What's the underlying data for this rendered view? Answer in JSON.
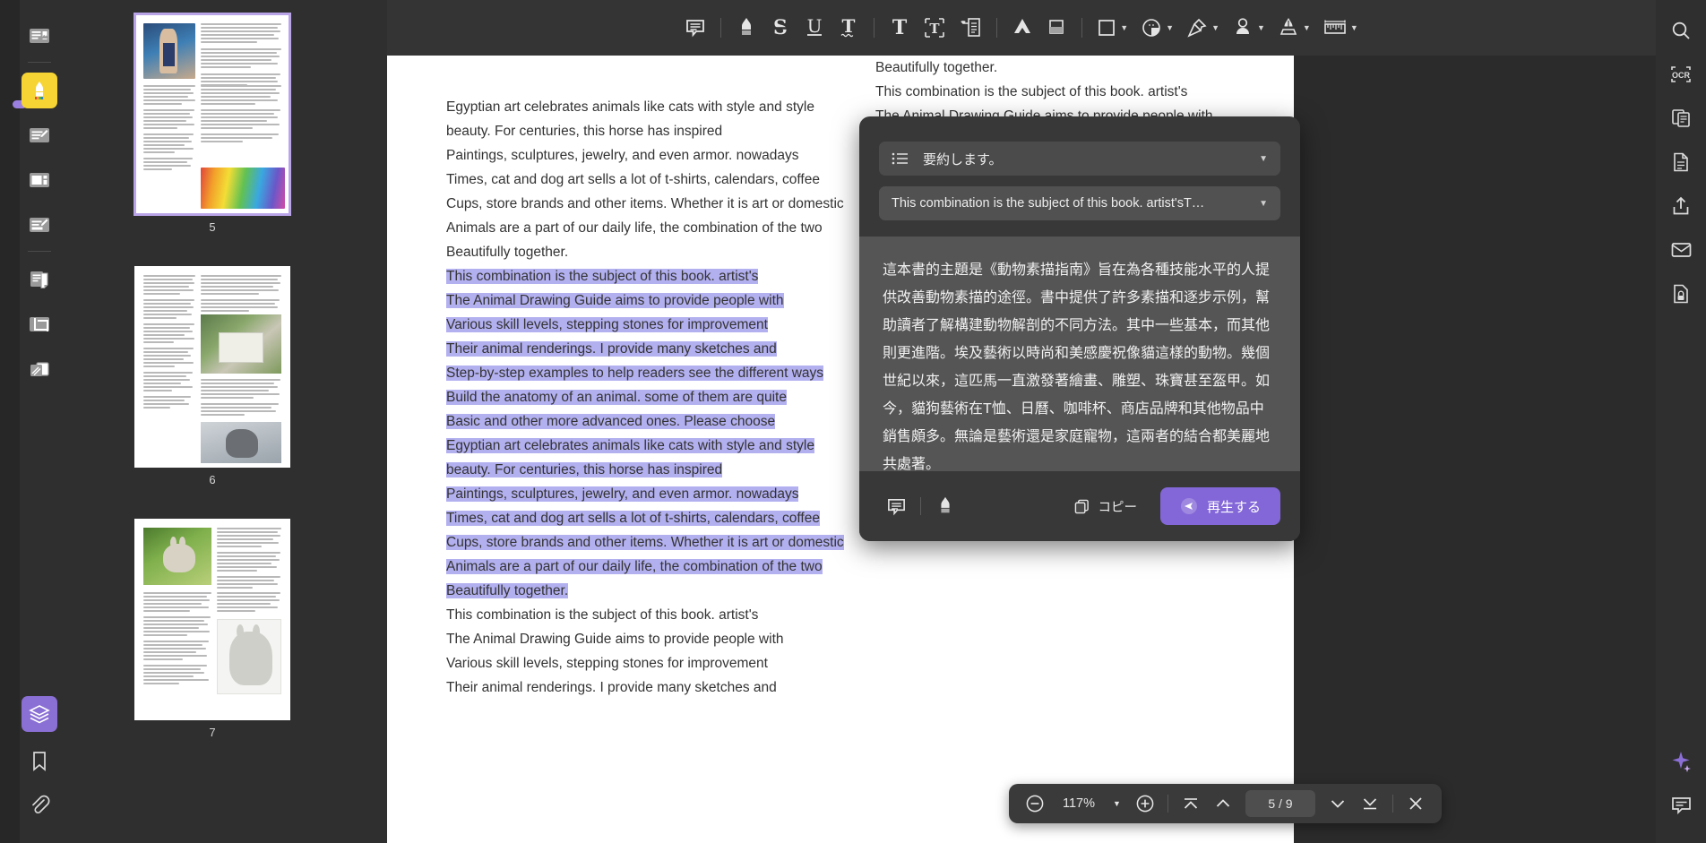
{
  "app": {
    "zoom_level": "117%",
    "page_indicator": "5 / 9"
  },
  "left_rail": {
    "items": [
      {
        "name": "page-text-tool",
        "icon": "document-image-icon",
        "state": "normal"
      },
      {
        "name": "highlight-tool",
        "icon": "highlighter-icon",
        "state": "active-yellow"
      },
      {
        "name": "edit-text-tool",
        "icon": "edit-document-icon",
        "state": "normal"
      },
      {
        "name": "page-layout-tool",
        "icon": "layout-columns-icon",
        "state": "normal"
      },
      {
        "name": "annotate-tool",
        "icon": "annotate-page-icon",
        "state": "normal"
      },
      {
        "name": "organize-pages-tool",
        "icon": "copy-pages-icon",
        "state": "normal"
      },
      {
        "name": "crop-tool",
        "icon": "crop-icon",
        "state": "normal"
      },
      {
        "name": "stack-pages-tool",
        "icon": "stack-pages-icon",
        "state": "normal"
      }
    ],
    "bottom_items": [
      {
        "name": "ai-layers-tool",
        "icon": "layers-icon",
        "state": "active-purple"
      },
      {
        "name": "bookmark-tool",
        "icon": "bookmark-icon",
        "state": "normal"
      },
      {
        "name": "attachment-tool",
        "icon": "paperclip-icon",
        "state": "normal"
      }
    ]
  },
  "thumbnails": {
    "pages": [
      {
        "number": "5",
        "selected": true
      },
      {
        "number": "6",
        "selected": false
      },
      {
        "number": "7",
        "selected": false
      }
    ]
  },
  "toolbar": {
    "items": [
      {
        "name": "comment-tool",
        "icon": "comment-icon",
        "label": "",
        "caret": false
      },
      {
        "name": "highlight-tool",
        "icon": "highlighter-icon",
        "label": "",
        "caret": false
      },
      {
        "name": "strikethrough-tool",
        "icon": "strikethrough-icon",
        "label": "S",
        "caret": false
      },
      {
        "name": "underline-tool",
        "icon": "underline-icon",
        "label": "U",
        "caret": false
      },
      {
        "name": "squiggly-tool",
        "icon": "squiggly-icon",
        "label": "T",
        "caret": false
      },
      {
        "name": "text-tool",
        "icon": "text-icon",
        "label": "T",
        "caret": false
      },
      {
        "name": "text-box-tool",
        "icon": "text-box-icon",
        "label": "",
        "caret": false
      },
      {
        "name": "callout-tool",
        "icon": "callout-icon",
        "label": "",
        "caret": false
      },
      {
        "name": "pencil-tool",
        "icon": "pencil-icon",
        "label": "",
        "caret": false
      },
      {
        "name": "eraser-tool",
        "icon": "eraser-icon",
        "label": "",
        "caret": false
      },
      {
        "name": "shape-tool",
        "icon": "square-shape-icon",
        "label": "",
        "caret": true
      },
      {
        "name": "sticky-note-tool",
        "icon": "sticky-note-icon",
        "label": "",
        "caret": true
      },
      {
        "name": "pin-tool",
        "icon": "pin-icon",
        "label": "",
        "caret": true
      },
      {
        "name": "stamp-tool",
        "icon": "stamp-person-icon",
        "label": "",
        "caret": true
      },
      {
        "name": "signature-tool",
        "icon": "fountain-pen-icon",
        "label": "",
        "caret": true
      },
      {
        "name": "measure-tool",
        "icon": "ruler-icon",
        "label": "",
        "caret": true
      }
    ]
  },
  "document": {
    "lines": [
      {
        "text": "Egyptian art celebrates animals like cats with style and style",
        "highlighted": false
      },
      {
        "text": "beauty. For centuries, this horse has inspired",
        "highlighted": false
      },
      {
        "text": "Paintings, sculptures, jewelry, and even armor. nowadays",
        "highlighted": false
      },
      {
        "text": "Times, cat and dog art sells a lot of t-shirts, calendars, coffee",
        "highlighted": false
      },
      {
        "text": "Cups, store brands and other items. Whether it is art or domestic",
        "highlighted": false
      },
      {
        "text": "Animals are a part of our daily life, the combination of the two",
        "highlighted": false
      },
      {
        "text": "Beautifully together.",
        "highlighted": false
      },
      {
        "text": "This combination is the subject of this book. artist's",
        "highlighted": true
      },
      {
        "text": "The Animal Drawing Guide aims to provide people with",
        "highlighted": true
      },
      {
        "text": "Various skill levels, stepping stones for improvement",
        "highlighted": true
      },
      {
        "text": "Their animal renderings. I provide many sketches and",
        "highlighted": true
      },
      {
        "text": "Step-by-step examples to help readers see the different ways",
        "highlighted": true
      },
      {
        "text": "Build the anatomy of an animal. some of them are quite",
        "highlighted": true
      },
      {
        "text": "Basic and other more advanced ones. Please choose",
        "highlighted": true
      },
      {
        "text": "Egyptian art celebrates animals like cats with style and style",
        "highlighted": true
      },
      {
        "text": "beauty. For centuries, this horse has inspired",
        "highlighted": true
      },
      {
        "text": "Paintings, sculptures, jewelry, and even armor. nowadays",
        "highlighted": true
      },
      {
        "text": "Times, cat and dog art sells a lot of t-shirts, calendars, coffee",
        "highlighted": true
      },
      {
        "text": "Cups, store brands and other items. Whether it is art or domestic",
        "highlighted": true
      },
      {
        "text": "Animals are a part of our daily life, the combination of the two",
        "highlighted": true
      },
      {
        "text": "Beautifully together.",
        "highlighted": true
      },
      {
        "text": "This combination is the subject of this book. artist's",
        "highlighted": false
      },
      {
        "text": "The Animal Drawing Guide aims to provide people with",
        "highlighted": false
      },
      {
        "text": "Various skill levels, stepping stones for improvement",
        "highlighted": false
      },
      {
        "text": "Their animal renderings. I provide many sketches and",
        "highlighted": false
      }
    ],
    "right_column_lines": [
      {
        "text": "Beautifully together.",
        "highlighted": false
      },
      {
        "text": "This combination is the subject of this book. artist's",
        "highlighted": false
      },
      {
        "text": "The Animal Drawing Guide aims to provide people with",
        "highlighted": false
      }
    ]
  },
  "ai_panel": {
    "action_select": {
      "icon": "list-icon",
      "value": "要約します。",
      "caret": "chevron-down-icon"
    },
    "source_select": {
      "value": "This combination is the subject of this book. artist'sT…",
      "caret": "chevron-down-icon"
    },
    "result_text": "這本書的主題是《動物素描指南》旨在為各種技能水平的人提供改善動物素描的途徑。書中提供了許多素描和逐步示例，幫助讀者了解構建動物解剖的不同方法。其中一些基本，而其他則更進階。埃及藝術以時尚和美感慶祝像貓這樣的動物。幾個世紀以來，這匹馬一直激發著繪畫、雕塑、珠寶甚至盔甲。如今，貓狗藝術在T恤、日曆、咖啡杯、商店品牌和其他物品中銷售頗多。無論是藝術還是家庭寵物，這兩者的結合都美麗地共處著。",
    "actions": {
      "comment_icon": "comment-icon",
      "highlight_icon": "highlighter-icon",
      "copy_icon": "copy-icon",
      "copy_label": "コピー",
      "play_icon": "play-send-icon",
      "play_label": "再生する"
    },
    "accent_color": "#8367d8"
  },
  "page_toolbar": {
    "zoom_out_icon": "minus-circle-icon",
    "zoom_value": "117%",
    "zoom_caret": "chevron-down-icon",
    "zoom_in_icon": "plus-circle-icon",
    "first_page_icon": "jump-to-top-icon",
    "prev_page_icon": "chevron-up-icon",
    "page_value": "5 / 9",
    "next_page_icon": "chevron-down-icon",
    "last_page_icon": "jump-to-bottom-icon",
    "close_icon": "close-icon"
  },
  "right_rail": {
    "items": [
      {
        "name": "search-panel",
        "icon": "search-icon"
      },
      {
        "name": "ocr-panel",
        "icon": "ocr-icon"
      },
      {
        "name": "compare-panel",
        "icon": "compare-docs-icon"
      },
      {
        "name": "extract-panel",
        "icon": "extract-page-icon"
      },
      {
        "name": "share-panel",
        "icon": "share-icon"
      },
      {
        "name": "email-panel",
        "icon": "envelope-icon"
      },
      {
        "name": "protect-panel",
        "icon": "protect-doc-icon"
      }
    ],
    "bottom_items": [
      {
        "name": "ai-assistant",
        "icon": "ai-sparkle-icon"
      },
      {
        "name": "feedback",
        "icon": "chat-bubble-icon"
      }
    ]
  }
}
